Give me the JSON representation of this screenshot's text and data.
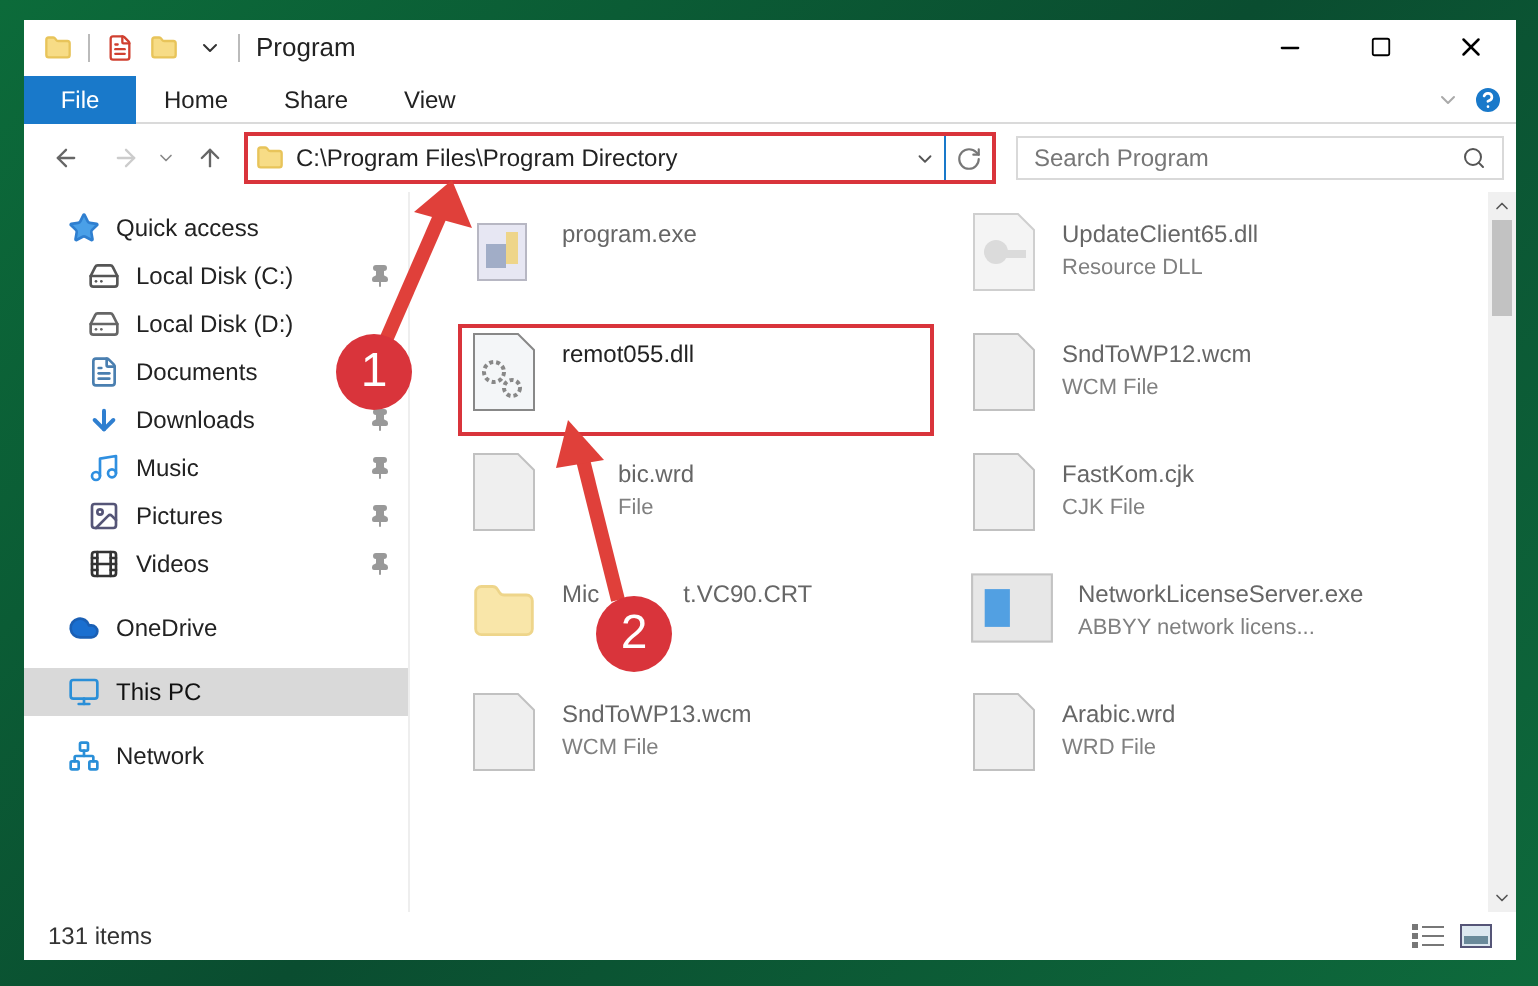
{
  "window": {
    "title": "Program"
  },
  "ribbon_tabs": [
    {
      "label": "File",
      "selected": true
    },
    {
      "label": "Home",
      "selected": false
    },
    {
      "label": "Share",
      "selected": false
    },
    {
      "label": "View",
      "selected": false
    }
  ],
  "address": {
    "path": "C:\\Program Files\\Program Directory",
    "marked": true
  },
  "search": {
    "placeholder": "Search Program"
  },
  "sidebar": {
    "items": [
      {
        "label": "Quick access",
        "kind": "quick",
        "selected": false,
        "children": [
          {
            "label": "Local Disk (C:)",
            "kind": "drive-c",
            "pinned": true
          },
          {
            "label": "Local Disk (D:)",
            "kind": "drive",
            "pinned": false
          },
          {
            "label": "Documents",
            "kind": "documents",
            "pinned": false
          },
          {
            "label": "Downloads",
            "kind": "downloads",
            "pinned": true
          },
          {
            "label": "Music",
            "kind": "music",
            "pinned": true
          },
          {
            "label": "Pictures",
            "kind": "pictures",
            "pinned": true
          },
          {
            "label": "Videos",
            "kind": "videos",
            "pinned": true
          }
        ]
      },
      {
        "label": "OneDrive",
        "kind": "onedrive",
        "selected": false
      },
      {
        "label": "This PC",
        "kind": "pc",
        "selected": true
      },
      {
        "label": "Network",
        "kind": "network",
        "selected": false
      }
    ]
  },
  "files": [
    {
      "name": "program.exe",
      "kind": "exe",
      "blurred": true,
      "marked": false
    },
    {
      "name": "UpdateClient65.dll",
      "type": "Resource DLL",
      "kind": "resource",
      "blurred": true,
      "marked": false
    },
    {
      "name": "remot055.dll",
      "kind": "gear",
      "blurred": false,
      "marked": true
    },
    {
      "name": "SndToWP12.wcm",
      "type": "WCM File",
      "kind": "file",
      "blurred": true,
      "marked": false
    },
    {
      "name": "bic.wrd",
      "type": "File",
      "kind": "file",
      "blurred": true,
      "marked": false,
      "indent": true
    },
    {
      "name": "FastKom.cjk",
      "type": "CJK File",
      "kind": "file",
      "blurred": true,
      "marked": false
    },
    {
      "name_parts": [
        "Mic",
        "t.VC90.CRT"
      ],
      "kind": "folder",
      "blurred": true,
      "marked": false
    },
    {
      "name": "NetworkLicenseServer.exe",
      "type": "ABBYY network licens...",
      "kind": "app",
      "blurred": true,
      "marked": false
    },
    {
      "name": "SndToWP13.wcm",
      "type": "WCM File",
      "kind": "file",
      "blurred": true,
      "marked": false
    },
    {
      "name": "Arabic.wrd",
      "type": "WRD File",
      "kind": "file",
      "blurred": true,
      "marked": false
    }
  ],
  "callouts": [
    {
      "number": "1"
    },
    {
      "number": "2"
    }
  ],
  "status_bar": {
    "count": "131 items"
  }
}
